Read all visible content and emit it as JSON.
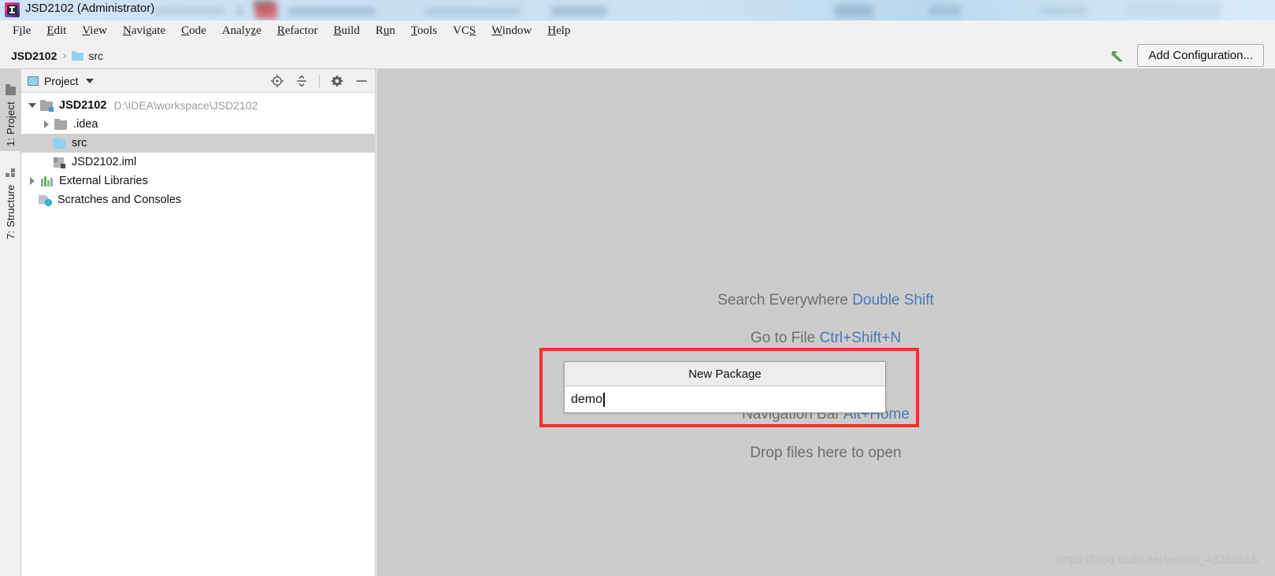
{
  "window": {
    "title": "JSD2102 (Administrator)",
    "app_icon": "intellij-idea-logo"
  },
  "menubar": {
    "items": [
      {
        "label": "File",
        "pre": "F",
        "mn": "i",
        "post": "le"
      },
      {
        "label": "Edit",
        "pre": "",
        "mn": "E",
        "post": "dit"
      },
      {
        "label": "View",
        "pre": "",
        "mn": "V",
        "post": "iew"
      },
      {
        "label": "Navigate",
        "pre": "",
        "mn": "N",
        "post": "avigate"
      },
      {
        "label": "Code",
        "pre": "",
        "mn": "C",
        "post": "ode"
      },
      {
        "label": "Analyze",
        "pre": "Analy",
        "mn": "z",
        "post": "e"
      },
      {
        "label": "Refactor",
        "pre": "",
        "mn": "R",
        "post": "efactor"
      },
      {
        "label": "Build",
        "pre": "",
        "mn": "B",
        "post": "uild"
      },
      {
        "label": "Run",
        "pre": "R",
        "mn": "u",
        "post": "n"
      },
      {
        "label": "Tools",
        "pre": "",
        "mn": "T",
        "post": "ools"
      },
      {
        "label": "VCS",
        "pre": "VC",
        "mn": "S",
        "post": ""
      },
      {
        "label": "Window",
        "pre": "",
        "mn": "W",
        "post": "indow"
      },
      {
        "label": "Help",
        "pre": "",
        "mn": "H",
        "post": "elp"
      }
    ]
  },
  "navbar": {
    "breadcrumb": {
      "project": "JSD2102",
      "separator": "›",
      "folder": "src",
      "folder_icon": "folder-icon"
    },
    "run_icon": "run-arrow-icon",
    "add_configuration_label": "Add Configuration..."
  },
  "sidestrip": {
    "tabs": [
      {
        "label": "1: Project",
        "icon": "folder-icon",
        "active": true
      },
      {
        "label": "7: Structure",
        "icon": "structure-icon",
        "active": false
      }
    ]
  },
  "project_panel": {
    "header": {
      "title": "Project",
      "icon": "project-window-icon",
      "dropdown_icon": "chevron-down-icon",
      "tools": [
        {
          "name": "locate-in-tree-icon"
        },
        {
          "name": "collapse-all-icon"
        },
        {
          "name": "gear-icon"
        },
        {
          "name": "minimize-icon"
        }
      ]
    },
    "tree": [
      {
        "label": "JSD2102",
        "path": "D:\\IDEA\\workspace\\JSD2102",
        "icon": "module-icon",
        "twisty": "open",
        "depth": 0,
        "bold": true,
        "selected": false
      },
      {
        "label": ".idea",
        "path": "",
        "icon": "folder-gray-icon",
        "twisty": "closed",
        "depth": 1,
        "bold": false,
        "selected": false
      },
      {
        "label": "src",
        "path": "",
        "icon": "folder-blue-icon",
        "twisty": "none",
        "depth": 1,
        "bold": false,
        "selected": true
      },
      {
        "label": "JSD2102.iml",
        "path": "",
        "icon": "iml-file-icon",
        "twisty": "none",
        "depth": 1,
        "bold": false,
        "selected": false
      },
      {
        "label": "External Libraries",
        "path": "",
        "icon": "libraries-icon",
        "twisty": "closed",
        "depth": 0,
        "bold": false,
        "selected": false
      },
      {
        "label": "Scratches and Consoles",
        "path": "",
        "icon": "scratches-icon",
        "twisty": "none",
        "depth": 0,
        "bold": false,
        "selected": false
      }
    ]
  },
  "editor": {
    "hints": [
      {
        "text": "Search Everywhere",
        "key": "Double Shift"
      },
      {
        "text": "Go to File",
        "key": "Ctrl+Shift+N"
      },
      {
        "text": "Navigation Bar",
        "key": "Alt+Home"
      },
      {
        "text": "Drop files here to open",
        "key": ""
      }
    ]
  },
  "dialog": {
    "title": "New Package",
    "input_value": "demo",
    "has_caret": true
  },
  "annotation": {
    "color": "#ee3229"
  },
  "watermark": {
    "text": "https://blog.csdn.net/weixin_48233516"
  },
  "colors": {
    "editor_background": "#cccccc",
    "panel_background": "#ffffff",
    "chrome_background": "#f1f1f1",
    "selection": "#d0d0d0",
    "key_hint": "#4a76b8",
    "folder_blue": "#8ed3ef",
    "annotation_red": "#ee3229"
  }
}
